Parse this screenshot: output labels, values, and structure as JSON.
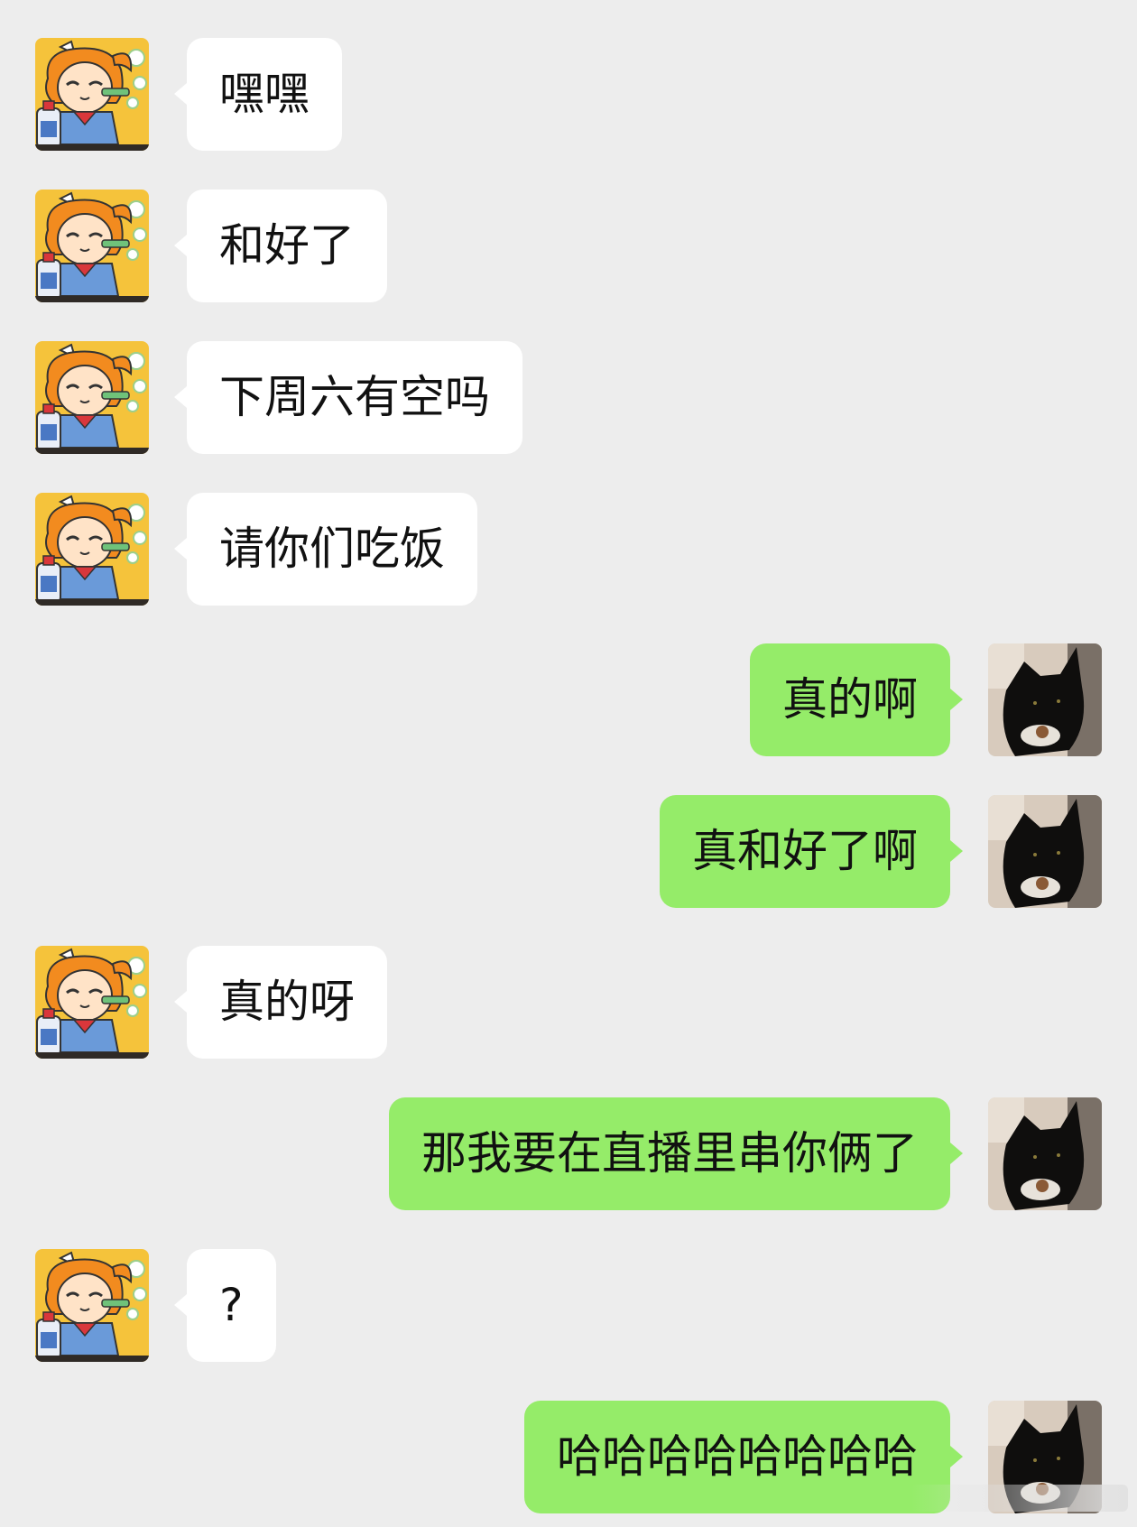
{
  "chat": {
    "bubble_colors": {
      "incoming": "#ffffff",
      "outgoing": "#95ec69",
      "background": "#ededed"
    },
    "messages": [
      {
        "sender": "other",
        "text": "嘿嘿"
      },
      {
        "sender": "other",
        "text": "和好了"
      },
      {
        "sender": "other",
        "text": "下周六有空吗"
      },
      {
        "sender": "other",
        "text": "请你们吃饭"
      },
      {
        "sender": "self",
        "text": "真的啊"
      },
      {
        "sender": "self",
        "text": "真和好了啊"
      },
      {
        "sender": "other",
        "text": "真的呀"
      },
      {
        "sender": "self",
        "text": "那我要在直播里串你俩了"
      },
      {
        "sender": "other",
        "text": "?"
      },
      {
        "sender": "self",
        "text": "哈哈哈哈哈哈哈哈"
      }
    ]
  },
  "avatars": {
    "other": "cartoon-girl-avatar",
    "self": "black-cat-avatar"
  }
}
